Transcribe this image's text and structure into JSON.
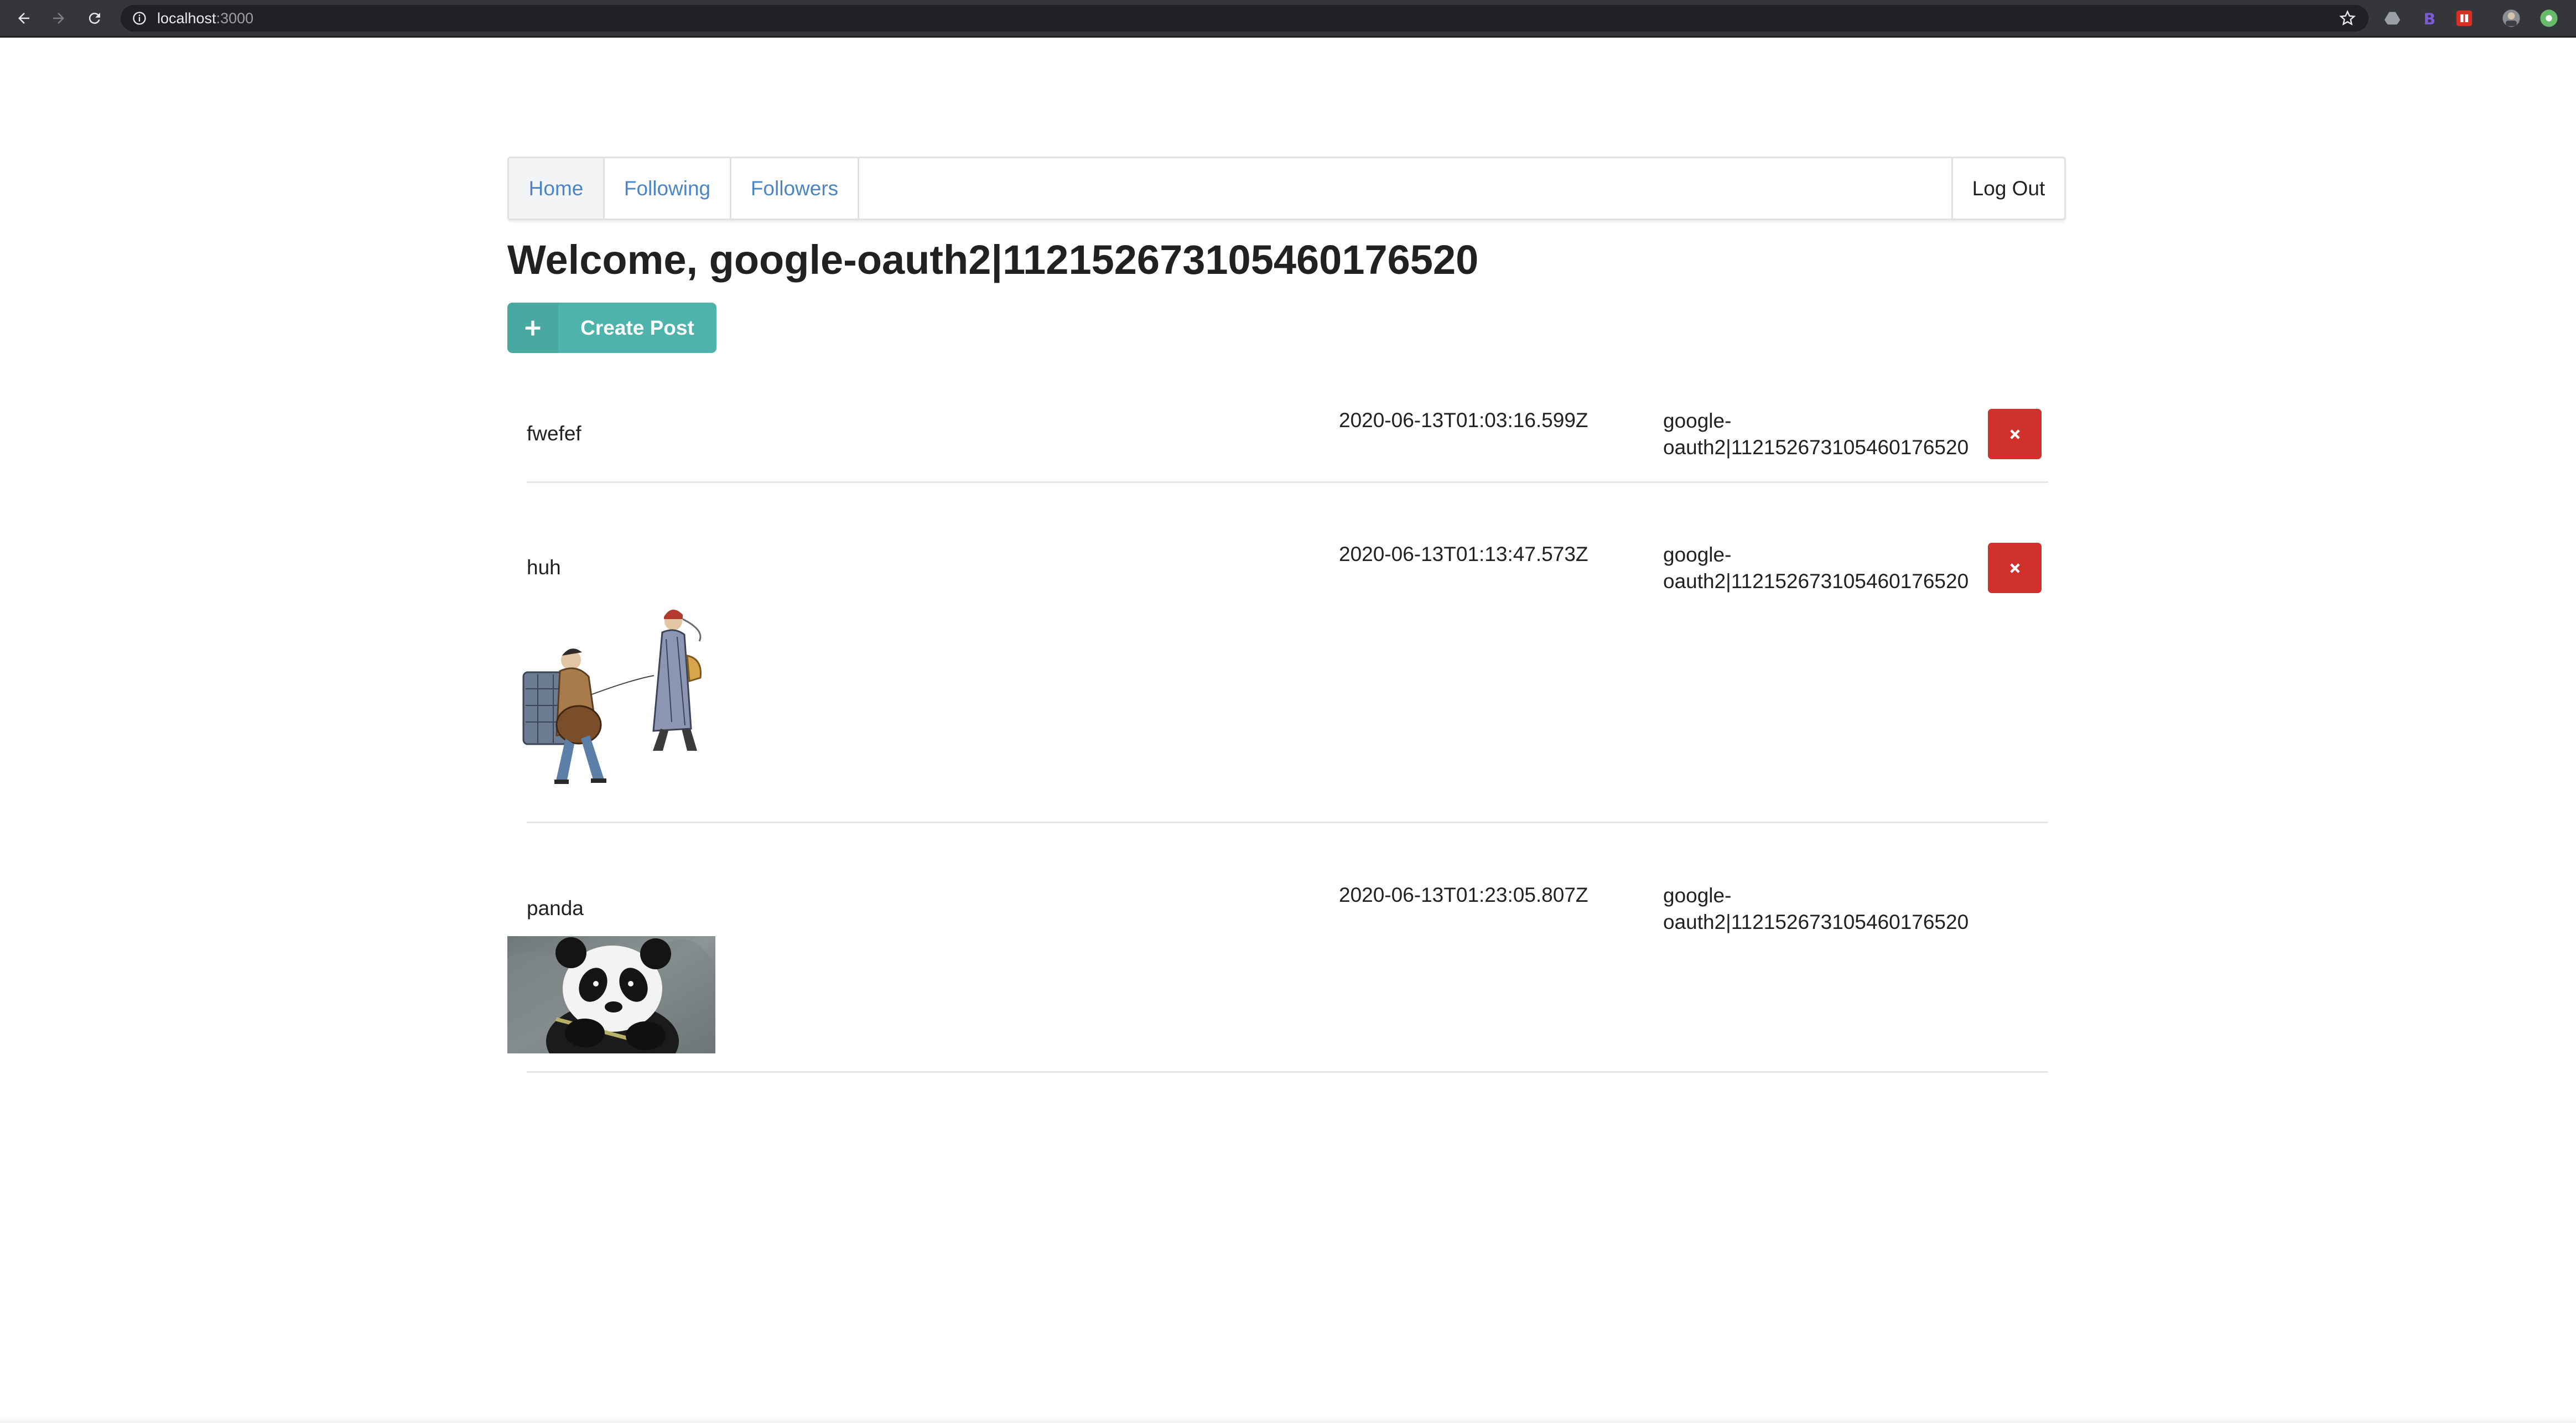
{
  "browser": {
    "url_host": "localhost",
    "url_port": ":3000"
  },
  "nav": {
    "tabs": [
      {
        "label": "Home",
        "active": true
      },
      {
        "label": "Following",
        "active": false
      },
      {
        "label": "Followers",
        "active": false
      }
    ],
    "logout_label": "Log Out"
  },
  "welcome": "Welcome, google-oauth2|112152673105460176520",
  "create_post_label": "Create Post",
  "posts": [
    {
      "content": "fwefef",
      "timestamp": "2020-06-13T01:03:16.599Z",
      "author_line1": "google-",
      "author_line2": "oauth2|112152673105460176520",
      "deletable": true,
      "image": null
    },
    {
      "content": "huh",
      "timestamp": "2020-06-13T01:13:47.573Z",
      "author_line1": "google-",
      "author_line2": "oauth2|112152673105460176520",
      "deletable": true,
      "image": "illustration of two travelers"
    },
    {
      "content": "panda",
      "timestamp": "2020-06-13T01:23:05.807Z",
      "author_line1": "google-",
      "author_line2": "oauth2|112152673105460176520",
      "deletable": false,
      "image": "giant panda photo"
    }
  ],
  "colors": {
    "accent_teal": "#4eb3aa",
    "danger_red": "#d0312d",
    "link_blue": "#4a86c5",
    "chrome_dark": "#35363a"
  }
}
